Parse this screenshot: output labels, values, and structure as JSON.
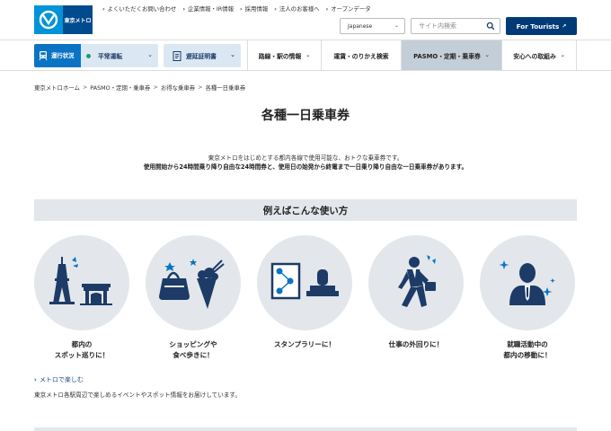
{
  "header": {
    "logo_text": "東京メトロ",
    "util_links": [
      {
        "label": "よくいただくお問い合わせ"
      },
      {
        "label": "企業情報・IR情報"
      },
      {
        "label": "採用情報"
      },
      {
        "label": "法人のお客様へ"
      },
      {
        "label": "オープンデータ"
      }
    ],
    "language": "Japanese",
    "search_placeholder": "サイト内検索",
    "tourists_label": "For Tourists"
  },
  "nav": {
    "status_label": "運行状況",
    "status_value": "平常運転",
    "delay_cert": "遅延証明書",
    "items": [
      {
        "label": "路線・駅の情報"
      },
      {
        "label": "運賃・のりかえ検索"
      },
      {
        "label": "PASMO・定期・乗車券"
      },
      {
        "label": "安心への取組み"
      }
    ]
  },
  "breadcrumb": [
    "東京メトロホーム",
    "PASMO・定期・乗車券",
    "お得な乗車券",
    "各種一日乗車券"
  ],
  "page": {
    "title": "各種一日乗車券",
    "intro_line1": "東京メトロをはじめとする都内各線で使用可能な、おトクな乗車券です。",
    "intro_line2": "使用開始から24時間乗り降り自由な24時間券と、使用日の始発から終電まで一日乗り降り自由な一日乗車券があります。"
  },
  "section": {
    "heading": "例えばこんな使い方",
    "uses": [
      {
        "line1": "都内の",
        "line2": "スポット巡りに！",
        "icon": "tokyo-tower-icon"
      },
      {
        "line1": "ショッピングや",
        "line2": "食べ歩きに！",
        "icon": "shopping-bag-icon"
      },
      {
        "line1": "スタンプラリーに！",
        "line2": "",
        "icon": "stamp-icon"
      },
      {
        "line1": "仕事の外回りに！",
        "line2": "",
        "icon": "businessman-icon"
      },
      {
        "line1": "就職活動中の",
        "line2": "都内の移動に！",
        "icon": "job-seeker-icon"
      }
    ],
    "more_link": "メトロで楽しむ",
    "more_desc": "東京メトロ各駅周辺で楽しめるイベントやスポット情報をお届けしています。"
  },
  "colors": {
    "navy": "#003b78",
    "brand_blue": "#0093d8",
    "icon_navy": "#1d3b66",
    "circle_bg": "#e3e7eb",
    "status_green": "#1aa06d"
  }
}
